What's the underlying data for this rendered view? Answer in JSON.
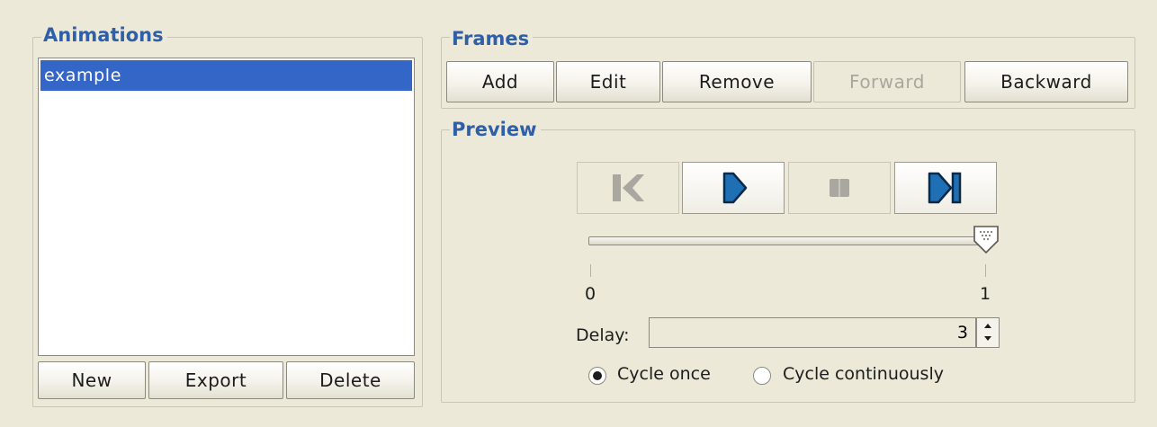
{
  "animations": {
    "title": "Animations",
    "items": [
      "example"
    ],
    "selected_index": 0,
    "buttons": {
      "new": "New",
      "export": "Export",
      "delete": "Delete"
    }
  },
  "frames": {
    "title": "Frames",
    "buttons": {
      "add": "Add",
      "edit": "Edit",
      "remove": "Remove",
      "forward": "Forward",
      "backward": "Backward"
    }
  },
  "preview": {
    "title": "Preview",
    "controls": [
      "rewind-icon",
      "play-icon",
      "stop-icon",
      "skip-to-end-icon"
    ],
    "slider": {
      "min_label": "0",
      "max_label": "1",
      "value": 1
    },
    "delay_label": "Delay:",
    "delay_value": "3",
    "cycle_once_label": "Cycle once",
    "cycle_continuously_label": "Cycle continuously",
    "cycle_selected": "once"
  },
  "colors": {
    "accent": "#2f5fa9",
    "selection": "#3466c8",
    "icon_blue": "#1f6fb5"
  }
}
